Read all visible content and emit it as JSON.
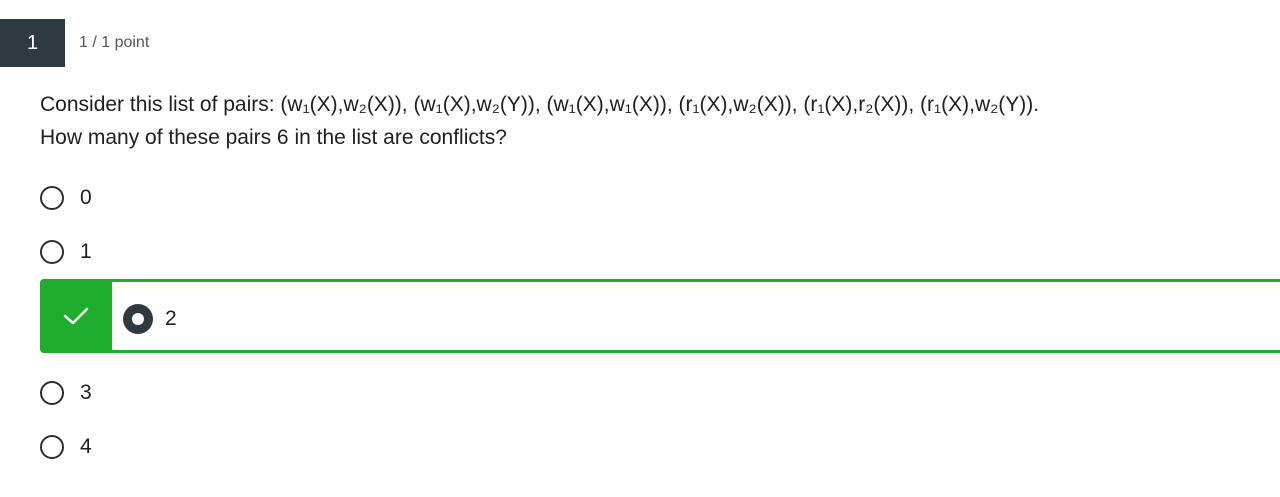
{
  "question": {
    "number": "1",
    "points": "1 / 1 point",
    "line1": "Consider this list of pairs: (w₁(X),w₂(X)), (w₁(X),w₂(Y)), (w₁(X),w₁(X)), (r₁(X),w₂(X)), (r₁(X),r₂(X)), (r₁(X),w₂(Y)).",
    "line2": "How many of these pairs 6 in the list are conflicts?"
  },
  "options": [
    {
      "label": "0"
    },
    {
      "label": "1"
    },
    {
      "label": "2"
    },
    {
      "label": "3"
    },
    {
      "label": "4"
    }
  ],
  "selected_index": 2,
  "colors": {
    "correct_green": "#1fad2d",
    "dark_slate": "#2e3a40"
  },
  "icons": {
    "correct": "check-icon"
  }
}
